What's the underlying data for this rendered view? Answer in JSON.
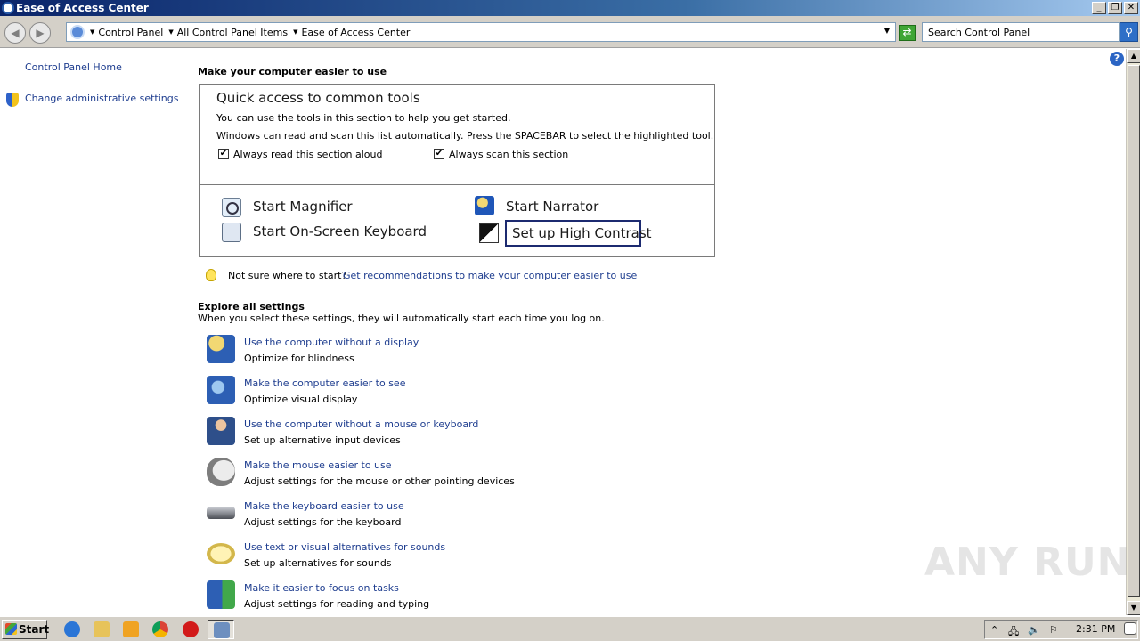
{
  "window": {
    "title": "Ease of Access Center"
  },
  "address": {
    "breadcrumbs": [
      "Control Panel",
      "All Control Panel Items",
      "Ease of Access Center"
    ],
    "search_placeholder": "Search Control Panel"
  },
  "sidebar": {
    "home_link": "Control Panel Home",
    "admin_link": "Change administrative settings"
  },
  "main": {
    "title": "Make your computer easier to use",
    "quick": {
      "title": "Quick access to common tools",
      "line1": "You can use the tools in this section to help you get started.",
      "line2": "Windows can read and scan this list automatically.  Press the SPACEBAR to select the highlighted tool.",
      "read_aloud": {
        "label": "Always read this section aloud",
        "checked": true
      },
      "scan": {
        "label": "Always scan this section",
        "checked": true
      },
      "tools": {
        "magnifier": "Start Magnifier",
        "narrator": "Start Narrator",
        "keyboard": "Start On-Screen Keyboard",
        "contrast": "Set up High Contrast"
      }
    },
    "tip": {
      "text": "Not sure where to start?",
      "link": "Get recommendations to make your computer easier to use"
    },
    "explore": {
      "title": "Explore all settings",
      "subtitle": "When you select these settings, they will automatically start each time you log on.",
      "items": [
        {
          "link": "Use the computer without a display",
          "desc": "Optimize for blindness"
        },
        {
          "link": "Make the computer easier to see",
          "desc": "Optimize visual display"
        },
        {
          "link": "Use the computer without a mouse or keyboard",
          "desc": "Set up alternative input devices"
        },
        {
          "link": "Make the mouse easier to use",
          "desc": "Adjust settings for the mouse or other pointing devices"
        },
        {
          "link": "Make the keyboard easier to use",
          "desc": "Adjust settings for the keyboard"
        },
        {
          "link": "Use text or visual alternatives for sounds",
          "desc": "Set up alternatives for sounds"
        },
        {
          "link": "Make it easier to focus on tasks",
          "desc": "Adjust settings for reading and typing"
        }
      ]
    }
  },
  "taskbar": {
    "start_label": "Start",
    "clock": "2:31 PM"
  },
  "watermark": "ANY RUN",
  "colors": {
    "link": "#1e3d8f",
    "titlebar": "#0a246a",
    "focus_border": "#1c2a70"
  },
  "icons": {
    "title": "ease-of-access-icon",
    "help": "help-icon",
    "shield": "shield-icon"
  }
}
